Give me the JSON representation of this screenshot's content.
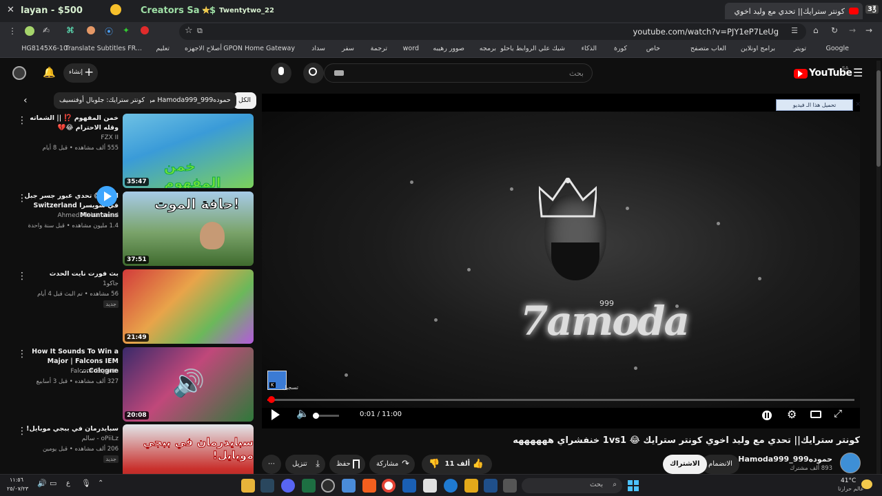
{
  "overlay": {
    "streamer": "layan - $500",
    "creator": "Creators Sa - $",
    "viewer": "Twentytwo_22"
  },
  "browser": {
    "tab_title": "كونتر سترايك|| تحدي مع وليد اخوي",
    "url": "youtube.com/watch?v=PJY1eP7LeUg",
    "bookmarks": [
      "Google",
      "تويتر",
      "برامج اونلاين",
      "العاب متصفح",
      "خاص",
      "كورة",
      "الذكاء",
      "شيك علي الروابط ياحلو",
      "برمجه",
      "صوور رهيبه",
      "word",
      "ترجمة",
      "سفر",
      "سداد",
      "GPON Home Gateway",
      "أصلاح الاجهزه",
      "تعليم",
      "Translate Subtitles FR...",
      "HG8145X6-10"
    ]
  },
  "youtube": {
    "logo": "YouTube",
    "region": "SA",
    "search_placeholder": "بحث",
    "create_label": "إنشاء",
    "chips": [
      "الكل",
      "من Hamoda999_حموده999",
      "كونتر سترايك: جلوبال أوفنسيف"
    ]
  },
  "player": {
    "ad_label": "تحميل هذا الـ فيديو",
    "logo_text": "7amoda",
    "logo_sup": "999",
    "subscribe_watermark": "تسجيل",
    "time": "0:01 / 11:00",
    "progress_fraction": 0.0015
  },
  "video": {
    "title": "كونتر سترايك|| تحدي مع وليد اخوي كونتر سترايك 😂 1vs1 خنفشراي ههههههه",
    "channel": "Hamoda999_حموده999",
    "subs": "893 ألف مشترك",
    "join": "الانضمام",
    "subscribe": "الاشتراك",
    "likes": "11 ألف",
    "share": "مشاركة",
    "save": "حفظ",
    "download": "تنزيل"
  },
  "recommendations": [
    {
      "title": "خمن المفهوم ⁉️ || الشماته وقله الاحترام 😂💔",
      "channel": "FZX II",
      "meta": "555 ألف مشاهده • قبل 8 أيام",
      "duration": "35:47",
      "thumb_text": "خمن المفهوم",
      "new": ""
    },
    {
      "title": "CH - 😱 تحدي عبور جسر جبل في سويسرا Switzerland Mountains",
      "channel": "Ahmed Alshammari",
      "meta": "1.4 مليون مشاهده • قبل سنة واحدة",
      "duration": "37:51",
      "thumb_text": "حافة الموت!",
      "new": ""
    },
    {
      "title": "بث فورت نايت الحدث",
      "channel": "جاكو1",
      "meta": "56 مشاهده • تم البث قبل 4 أيام",
      "duration": "21:49",
      "thumb_text": "",
      "new": "جديد"
    },
    {
      "title": "How It Sounds To Win a Major | Falcons IEM Cologne...",
      "channel": "Falcons Esports",
      "meta": "327 ألف مشاهده • قبل 3 أسابيع",
      "duration": "20:08",
      "thumb_text": "",
      "new": ""
    },
    {
      "title": "سبايدرمان في ببجي موبايل!",
      "channel": "oPiiLz - سالم",
      "meta": "206 ألف مشاهده • قبل يومين",
      "duration": "",
      "thumb_text": "سبايدرمان في ببجي موبايل!",
      "new": "جديد"
    }
  ],
  "taskbar": {
    "search_placeholder": "بحث",
    "weather_temp": "41°C",
    "weather_text": "عالم حرارتا",
    "time": "١١:٥٦",
    "date": "٢٥/٠٧/٢٣"
  },
  "colors": {
    "accent": "#ff0000",
    "bg": "#0f0f0f",
    "chip": "#272727"
  }
}
